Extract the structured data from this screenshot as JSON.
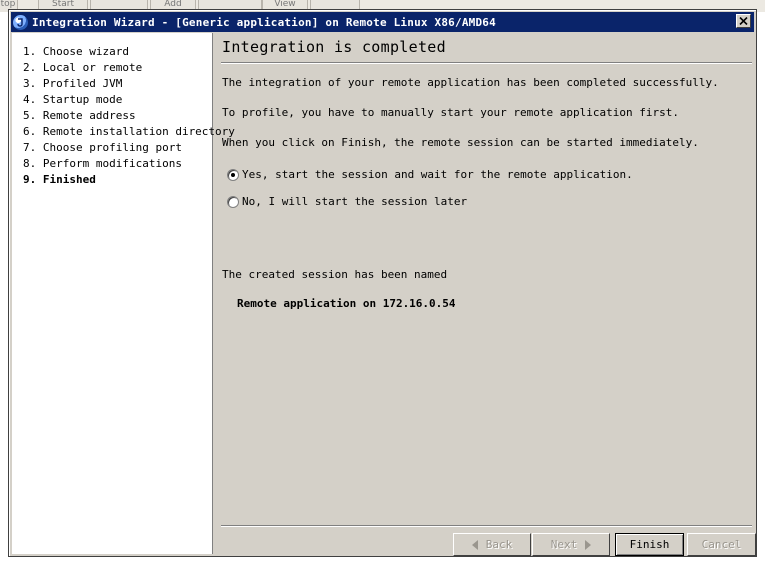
{
  "background": {
    "toolbar_buttons": [
      "top",
      "Start",
      "",
      "Add",
      "",
      "View",
      ""
    ]
  },
  "window": {
    "title": "Integration Wizard - [Generic application] on Remote Linux X86/AMD64",
    "close_label": "×"
  },
  "steps": [
    {
      "label": "1. Choose wizard"
    },
    {
      "label": "2. Local or remote"
    },
    {
      "label": "3. Profiled JVM"
    },
    {
      "label": "4. Startup mode"
    },
    {
      "label": "5. Remote address"
    },
    {
      "label": "6. Remote installation directory"
    },
    {
      "label": "7. Choose profiling port"
    },
    {
      "label": "8. Perform modifications"
    },
    {
      "label": "9. Finished"
    }
  ],
  "content": {
    "heading": "Integration is completed",
    "para1": "The integration of your remote application has been completed successfully.",
    "para2": "To profile, you have to manually start your remote application first.",
    "para3": "When you click on Finish, the remote session can be started immediately.",
    "option_yes": "Yes, start the session and wait for the remote application.",
    "option_no": "No, I will start the session later",
    "selected_option": "yes",
    "session_label": "The created session has been named",
    "session_name": "Remote application on 172.16.0.54"
  },
  "buttons": {
    "back": "Back",
    "next": "Next",
    "finish": "Finish",
    "cancel": "Cancel"
  },
  "colors": {
    "titlebar": "#0a246a",
    "dialog_bg": "#d4d0c8"
  }
}
